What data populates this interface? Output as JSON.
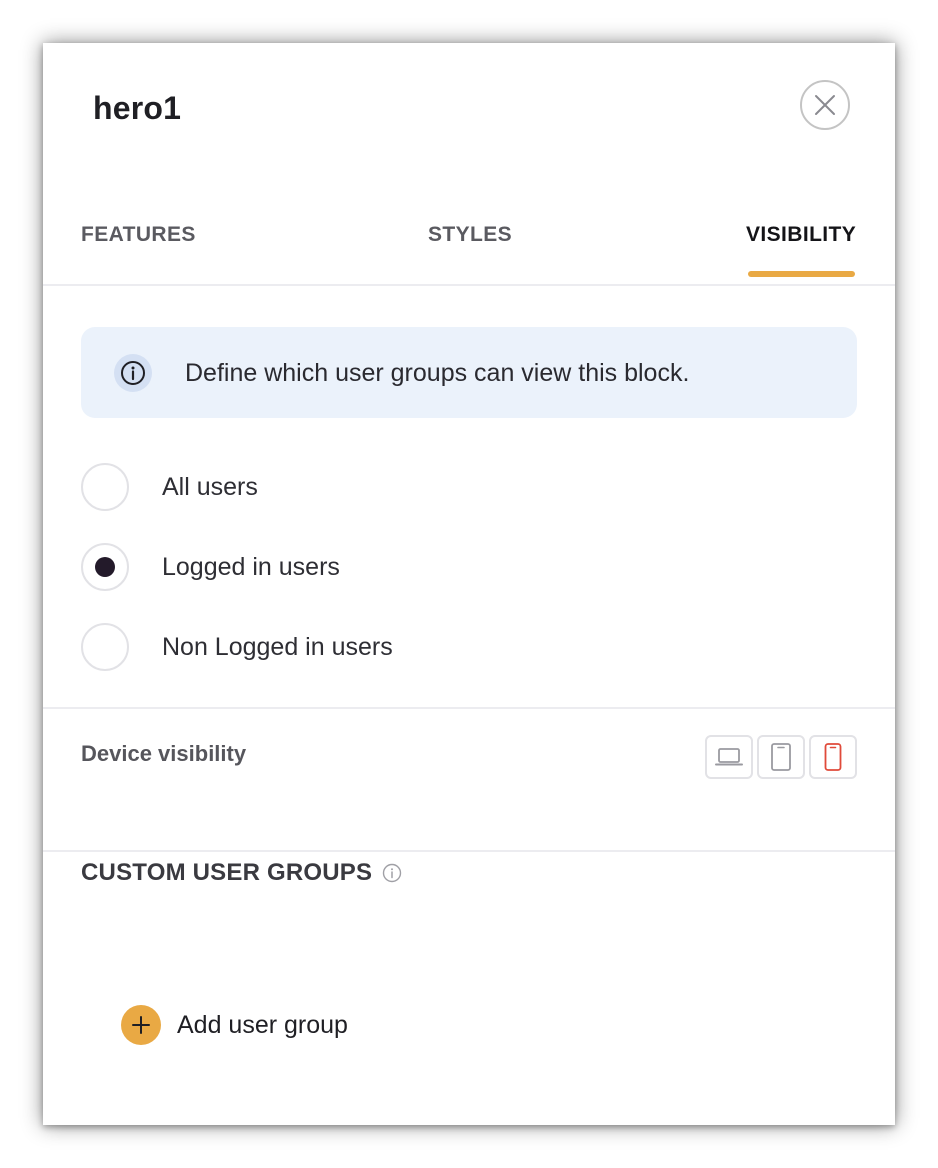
{
  "panel": {
    "title": "hero1"
  },
  "tabs": [
    {
      "label": "FEATURES",
      "active": false
    },
    {
      "label": "STYLES",
      "active": false
    },
    {
      "label": "VISIBILITY",
      "active": true
    }
  ],
  "info": {
    "text": "Define which user groups can view this block.",
    "icon": "info-icon"
  },
  "visibility_options": [
    {
      "label": "All users",
      "selected": false
    },
    {
      "label": "Logged in users",
      "selected": true
    },
    {
      "label": "Non Logged in users",
      "selected": false
    }
  ],
  "device_visibility": {
    "label": "Device visibility",
    "devices": [
      {
        "icon": "laptop-icon",
        "active": false
      },
      {
        "icon": "tablet-icon",
        "active": false
      },
      {
        "icon": "mobile-icon",
        "active": true
      }
    ]
  },
  "custom_groups": {
    "title": "CUSTOM USER GROUPS",
    "add_label": "Add user group"
  },
  "colors": {
    "accent": "#e9a944",
    "info_background": "#ebf2fb",
    "selected_radio": "#231a2a",
    "active_device": "#e04a3a"
  }
}
